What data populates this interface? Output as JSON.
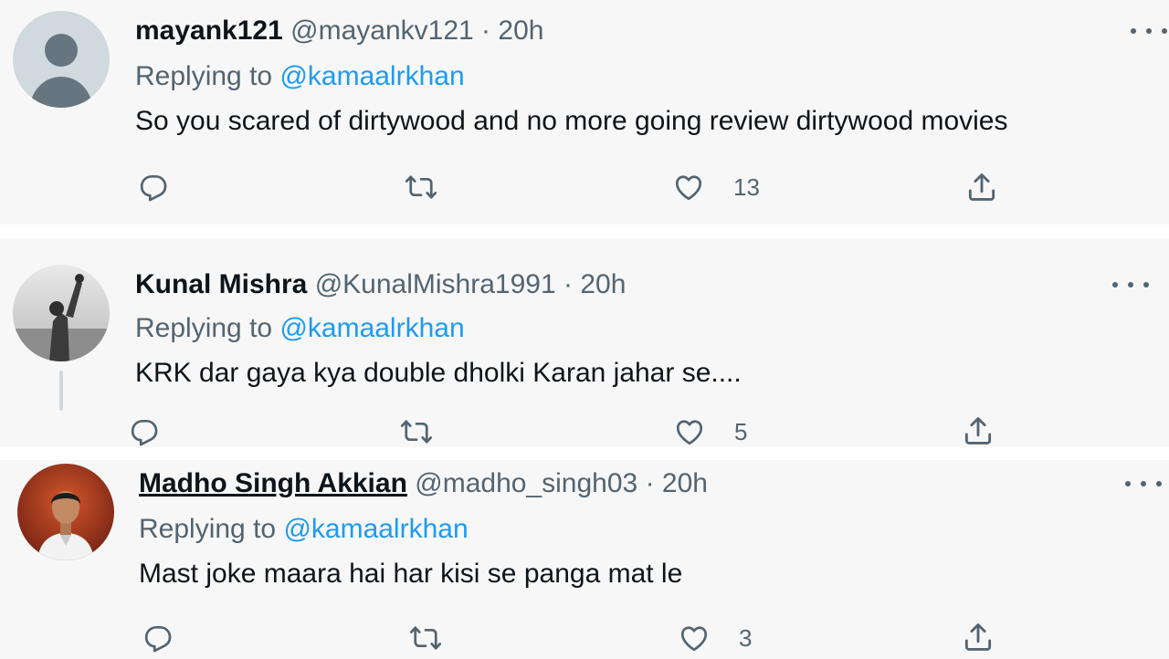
{
  "tweets": [
    {
      "name": "mayank121",
      "handle": "@mayankv121",
      "dot": "·",
      "time": "20h",
      "replying_prefix": "Replying to",
      "replying_to": "@kamaalrkhan",
      "text": "So you scared of dirtywood and no more going review dirtywood movies",
      "likes": "13",
      "avatar_icon": "default-profile-icon"
    },
    {
      "name": "Kunal Mishra",
      "handle": "@KunalMishra1991",
      "dot": "·",
      "time": "20h",
      "replying_prefix": "Replying to",
      "replying_to": "@kamaalrkhan",
      "text": "KRK dar gaya kya double dholki Karan jahar se....",
      "likes": "5",
      "avatar_icon": "photo-avatar"
    },
    {
      "name": "Madho Singh Akkian",
      "handle": "@madho_singh03",
      "dot": "·",
      "time": "20h",
      "replying_prefix": "Replying to",
      "replying_to": "@kamaalrkhan",
      "text": "Mast joke maara hai har kisi se panga  mat le",
      "likes": "3",
      "avatar_icon": "photo-avatar"
    }
  ],
  "colors": {
    "accent": "#1d9bf0",
    "secondary_text": "#536471",
    "background": "#f7f7f7"
  },
  "icons": [
    "reply-icon",
    "retweet-icon",
    "like-icon",
    "share-icon",
    "more-options-icon"
  ]
}
